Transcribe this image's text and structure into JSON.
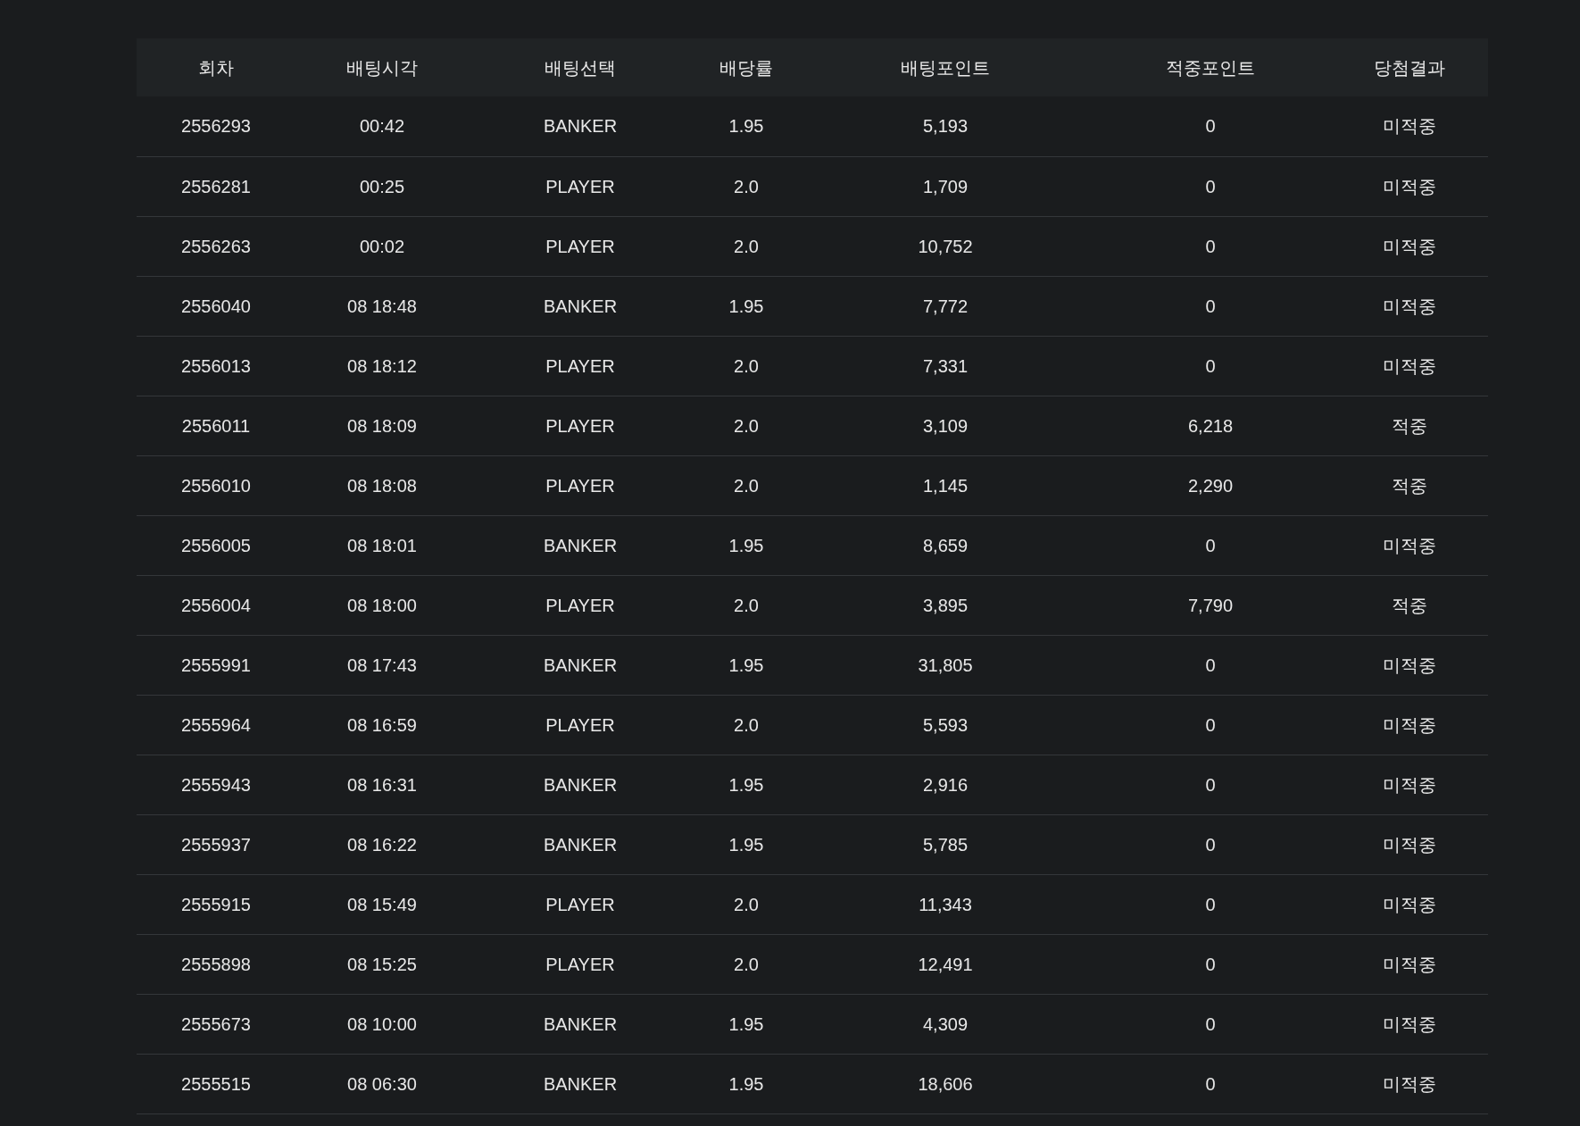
{
  "table": {
    "columns": [
      "회차",
      "배팅시각",
      "배팅선택",
      "배당률",
      "배팅포인트",
      "적중포인트",
      "당첨결과"
    ],
    "rows": [
      [
        "2556293",
        "00:42",
        "BANKER",
        "1.95",
        "5,193",
        "0",
        "미적중"
      ],
      [
        "2556281",
        "00:25",
        "PLAYER",
        "2.0",
        "1,709",
        "0",
        "미적중"
      ],
      [
        "2556263",
        "00:02",
        "PLAYER",
        "2.0",
        "10,752",
        "0",
        "미적중"
      ],
      [
        "2556040",
        "08 18:48",
        "BANKER",
        "1.95",
        "7,772",
        "0",
        "미적중"
      ],
      [
        "2556013",
        "08 18:12",
        "PLAYER",
        "2.0",
        "7,331",
        "0",
        "미적중"
      ],
      [
        "2556011",
        "08 18:09",
        "PLAYER",
        "2.0",
        "3,109",
        "6,218",
        "적중"
      ],
      [
        "2556010",
        "08 18:08",
        "PLAYER",
        "2.0",
        "1,145",
        "2,290",
        "적중"
      ],
      [
        "2556005",
        "08 18:01",
        "BANKER",
        "1.95",
        "8,659",
        "0",
        "미적중"
      ],
      [
        "2556004",
        "08 18:00",
        "PLAYER",
        "2.0",
        "3,895",
        "7,790",
        "적중"
      ],
      [
        "2555991",
        "08 17:43",
        "BANKER",
        "1.95",
        "31,805",
        "0",
        "미적중"
      ],
      [
        "2555964",
        "08 16:59",
        "PLAYER",
        "2.0",
        "5,593",
        "0",
        "미적중"
      ],
      [
        "2555943",
        "08 16:31",
        "BANKER",
        "1.95",
        "2,916",
        "0",
        "미적중"
      ],
      [
        "2555937",
        "08 16:22",
        "BANKER",
        "1.95",
        "5,785",
        "0",
        "미적중"
      ],
      [
        "2555915",
        "08 15:49",
        "PLAYER",
        "2.0",
        "11,343",
        "0",
        "미적중"
      ],
      [
        "2555898",
        "08 15:25",
        "PLAYER",
        "2.0",
        "12,491",
        "0",
        "미적중"
      ],
      [
        "2555673",
        "08 10:00",
        "BANKER",
        "1.95",
        "4,309",
        "0",
        "미적중"
      ],
      [
        "2555515",
        "08 06:30",
        "BANKER",
        "1.95",
        "18,606",
        "0",
        "미적중"
      ]
    ]
  }
}
